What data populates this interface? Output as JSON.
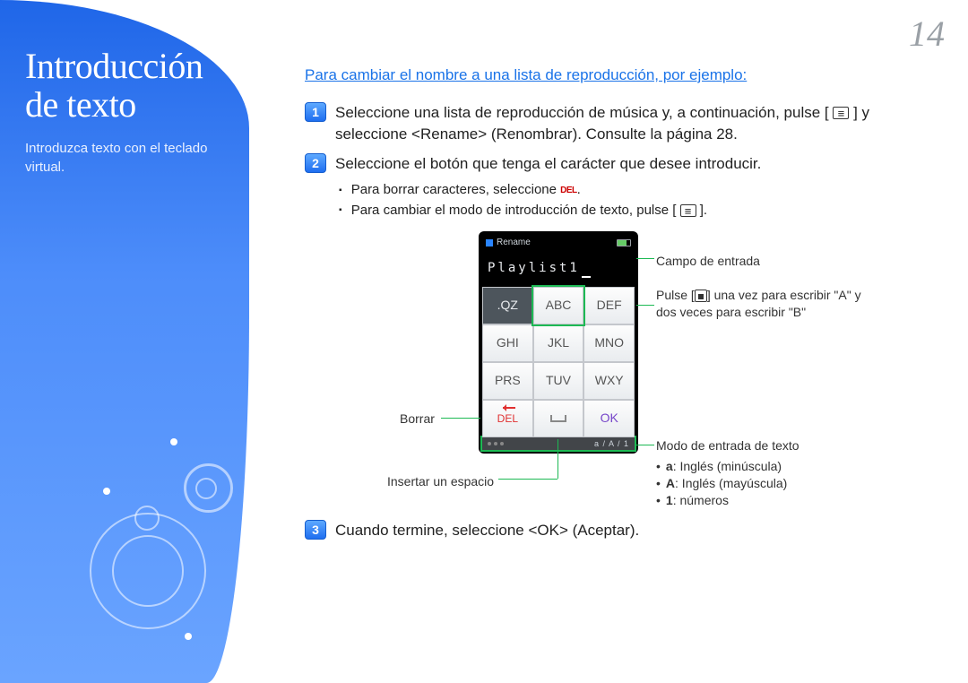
{
  "page_number": "14",
  "sidebar": {
    "title": "Introducción de texto",
    "subtitle": "Introduzca texto con el teclado virtual."
  },
  "heading": "Para cambiar el nombre a una lista de reproducción, por ejemplo:",
  "steps": {
    "s1_num": "1",
    "s1a": "Seleccione una lista de reproducción de música y, a continuación, pulse [",
    "s1b": "] y seleccione <Rename> (Renombrar). Consulte la página 28.",
    "s2_num": "2",
    "s2": "Seleccione el botón que tenga el carácter que desee introducir.",
    "s2_sub1a": "Para borrar caracteres, seleccione ",
    "s2_sub1b": ".",
    "s2_sub2a": "Para cambiar el modo de introducción de texto, pulse [",
    "s2_sub2b": "].",
    "s3_num": "3",
    "s3": "Cuando termine, seleccione <OK> (Aceptar)."
  },
  "diagram": {
    "window_title": "Rename",
    "input_text": "Playlist1",
    "keys": {
      "qz": ".QZ",
      "abc": "ABC",
      "def": "DEF",
      "ghi": "GHI",
      "jkl": "JKL",
      "mno": "MNO",
      "prs": "PRS",
      "tuv": "TUV",
      "wxy": "WXY",
      "del": "DEL",
      "ok": "OK"
    },
    "modebar": "a / A / 1",
    "callouts": {
      "field": "Campo de entrada",
      "abc": "Pulse [ ▪ ] una vez para escribir \"A\" y dos veces para escribir \"B\"",
      "del": "Borrar",
      "space": "Insertar un espacio",
      "mode_title": "Modo de entrada de texto",
      "mode_a": ": Inglés (minúscula)",
      "mode_A": ": Inglés (mayúscula)",
      "mode_1": ": números",
      "mode_glyph_a": "a",
      "mode_glyph_A": "A",
      "mode_glyph_1": "1"
    }
  }
}
